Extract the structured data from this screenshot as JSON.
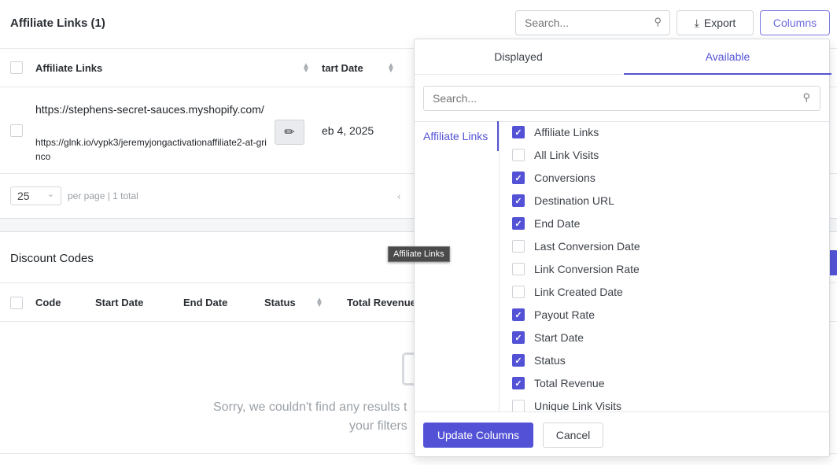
{
  "affiliate": {
    "title": "Affiliate Links (1)",
    "search_placeholder": "Search...",
    "export_label": "Export",
    "columns_label": "Columns",
    "columns": [
      "Affiliate Links",
      "tart Date"
    ],
    "row": {
      "destination": "https://stephens-secret-sauces.myshopify.com/",
      "link": "https://glnk.io/vypk3/jeremyjongactivationaffiliate2-at-grinco",
      "start_date": "eb 4, 2025"
    },
    "per_page": "25",
    "pagination_text": "per page | 1 total"
  },
  "discount": {
    "title": "Discount Codes",
    "columns": [
      "Code",
      "Start Date",
      "End Date",
      "Status",
      "Total Revenue"
    ],
    "empty_line1": "Sorry, we couldn't find any results t",
    "empty_line2": "your filters"
  },
  "tooltip": "Affiliate Links",
  "columns_panel": {
    "tabs": [
      {
        "label": "Displayed",
        "active": false
      },
      {
        "label": "Available",
        "active": true
      }
    ],
    "search_placeholder": "Search...",
    "group": "Affiliate Links",
    "items": [
      {
        "label": "Affiliate Links",
        "checked": true
      },
      {
        "label": "All Link Visits",
        "checked": false
      },
      {
        "label": "Conversions",
        "checked": true
      },
      {
        "label": "Destination URL",
        "checked": true
      },
      {
        "label": "End Date",
        "checked": true
      },
      {
        "label": "Last Conversion Date",
        "checked": false
      },
      {
        "label": "Link Conversion Rate",
        "checked": false
      },
      {
        "label": "Link Created Date",
        "checked": false
      },
      {
        "label": "Payout Rate",
        "checked": true
      },
      {
        "label": "Start Date",
        "checked": true
      },
      {
        "label": "Status",
        "checked": true
      },
      {
        "label": "Total Revenue",
        "checked": true
      },
      {
        "label": "Unique Link Visits",
        "checked": false
      }
    ],
    "update_label": "Update Columns",
    "cancel_label": "Cancel"
  },
  "colors": {
    "accent": "#5352d6"
  }
}
